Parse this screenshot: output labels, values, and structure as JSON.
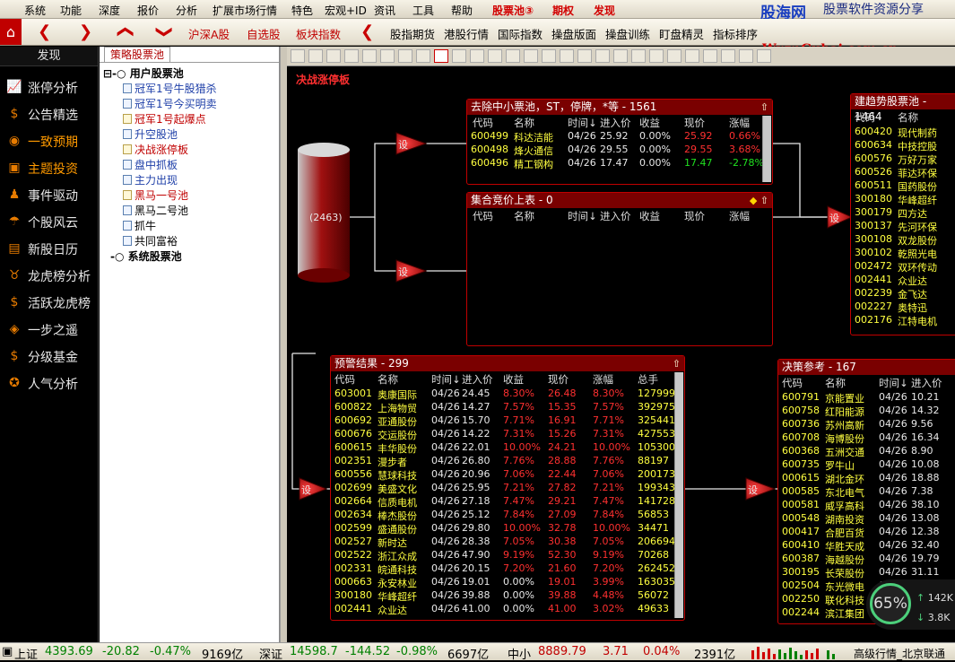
{
  "menubar": {
    "items": [
      "系统",
      "功能",
      "深度",
      "报价",
      "分析",
      "扩展市场行情",
      "特色",
      "宏观+ID",
      "资讯",
      "工具",
      "帮助"
    ],
    "stockpool": "股票池",
    "stockpool_badge": "③",
    "options": "期权",
    "ipo": "发现"
  },
  "watermark": {
    "brand": "股海网",
    "slogan": "股票软件资源分享",
    "url": "Www.Guhai.com.cn"
  },
  "toolbar": {
    "buttons": [
      "沪深A股",
      "自选股",
      "板块指数",
      "股指期货",
      "港股行情",
      "国际指数",
      "操盘版面",
      "操盘训练",
      "盯盘精灵",
      "指标排序"
    ]
  },
  "leftnav": {
    "title": "发现",
    "items": [
      "涨停分析",
      "公告精选",
      "一致预期",
      "主题投资",
      "事件驱动",
      "个股风云",
      "新股日历",
      "龙虎榜分析",
      "活跃龙虎榜",
      "一步之遥",
      "分级基金",
      "人气分析"
    ]
  },
  "tree": {
    "tab": "策略股票池",
    "user_pool": "用户股票池",
    "items": [
      "冠军1号牛股猎杀",
      "冠军1号今买明卖",
      "冠军1号起爆点",
      "升空股池",
      "决战涨停板",
      "盘中抓板",
      "主力出现",
      "黑马一号池",
      "黑马二号池",
      "抓牛",
      "共同富裕"
    ],
    "system_pool": "系统股票池"
  },
  "strategy_title": "决战涨停板",
  "pool_count": "(2463)",
  "set_label": "设",
  "headers": {
    "code": "代码",
    "name": "名称",
    "time": "时间↓",
    "entry": "进入价",
    "profit": "收益",
    "price": "现价",
    "change": "涨幅",
    "volume": "总手"
  },
  "panel_exclude": {
    "title": "去除中小票池，ST，停牌，*等 - 1561",
    "rows": [
      [
        "600499",
        "科达洁能",
        "04/26",
        "25.92",
        "0.00%",
        "25.92",
        "0.66%"
      ],
      [
        "600498",
        "烽火通信",
        "04/26",
        "29.55",
        "0.00%",
        "29.55",
        "3.68%"
      ],
      [
        "600496",
        "精工钢构",
        "04/26",
        "17.47",
        "0.00%",
        "17.47",
        "-2.78%"
      ]
    ]
  },
  "panel_auction": {
    "title": "集合竞价上表 - 0"
  },
  "panel_trend": {
    "title": "建趋势股票池 - 1464",
    "rows": [
      [
        "600420",
        "现代制药"
      ],
      [
        "600634",
        "中技控股"
      ],
      [
        "600576",
        "万好万家"
      ],
      [
        "600526",
        "菲达环保"
      ],
      [
        "600511",
        "国药股份"
      ],
      [
        "300180",
        "华峰超纤"
      ],
      [
        "300179",
        "四方达"
      ],
      [
        "300137",
        "先河环保"
      ],
      [
        "300108",
        "双龙股份"
      ],
      [
        "300102",
        "乾照光电"
      ],
      [
        "002472",
        "双环传动"
      ],
      [
        "002441",
        "众业达"
      ],
      [
        "002239",
        "金飞达"
      ],
      [
        "002227",
        "奥特迅"
      ],
      [
        "002176",
        "江特电机"
      ]
    ]
  },
  "panel_alert": {
    "title": "预警结果 - 299",
    "rows": [
      [
        "603001",
        "奥康国际",
        "04/26",
        "24.45",
        "8.30%",
        "26.48",
        "8.30%",
        "127999"
      ],
      [
        "600822",
        "上海物贸",
        "04/26",
        "14.27",
        "7.57%",
        "15.35",
        "7.57%",
        "392975"
      ],
      [
        "600692",
        "亚通股份",
        "04/26",
        "15.70",
        "7.71%",
        "16.91",
        "7.71%",
        "325441"
      ],
      [
        "600676",
        "交运股份",
        "04/26",
        "14.22",
        "7.31%",
        "15.26",
        "7.31%",
        "427553"
      ],
      [
        "600615",
        "丰华股份",
        "04/26",
        "22.01",
        "10.00%",
        "24.21",
        "10.00%",
        "105300"
      ],
      [
        "002351",
        "漫步者",
        "04/26",
        "26.80",
        "7.76%",
        "28.88",
        "7.76%",
        "88197"
      ],
      [
        "600556",
        "慧球科技",
        "04/26",
        "20.96",
        "7.06%",
        "22.44",
        "7.06%",
        "200173"
      ],
      [
        "002699",
        "美盛文化",
        "04/26",
        "25.95",
        "7.21%",
        "27.82",
        "7.21%",
        "199343"
      ],
      [
        "002664",
        "信质电机",
        "04/26",
        "27.18",
        "7.47%",
        "29.21",
        "7.47%",
        "141728"
      ],
      [
        "002634",
        "棒杰股份",
        "04/26",
        "25.12",
        "7.84%",
        "27.09",
        "7.84%",
        "56853"
      ],
      [
        "002599",
        "盛通股份",
        "04/26",
        "29.80",
        "10.00%",
        "32.78",
        "10.00%",
        "34471"
      ],
      [
        "002527",
        "新时达",
        "04/26",
        "28.38",
        "7.05%",
        "30.38",
        "7.05%",
        "206694"
      ],
      [
        "002522",
        "浙江众成",
        "04/26",
        "47.90",
        "9.19%",
        "52.30",
        "9.19%",
        "70268"
      ],
      [
        "002331",
        "皖通科技",
        "04/26",
        "20.15",
        "7.20%",
        "21.60",
        "7.20%",
        "262452"
      ],
      [
        "000663",
        "永安林业",
        "04/26",
        "19.01",
        "0.00%",
        "19.01",
        "3.99%",
        "163035"
      ],
      [
        "300180",
        "华峰超纤",
        "04/26",
        "39.88",
        "0.00%",
        "39.88",
        "4.48%",
        "56072"
      ],
      [
        "002441",
        "众业达",
        "04/26",
        "41.00",
        "0.00%",
        "41.00",
        "3.02%",
        "49633"
      ]
    ]
  },
  "panel_decision": {
    "title": "决策参考 - 167",
    "rows": [
      [
        "600791",
        "京能置业",
        "04/26",
        "10.21"
      ],
      [
        "600758",
        "红阳能源",
        "04/26",
        "14.32"
      ],
      [
        "600736",
        "苏州高新",
        "04/26",
        "9.56"
      ],
      [
        "600708",
        "海博股份",
        "04/26",
        "16.34"
      ],
      [
        "600368",
        "五洲交通",
        "04/26",
        "8.90"
      ],
      [
        "600735",
        "罗牛山",
        "04/26",
        "10.08"
      ],
      [
        "000615",
        "湖北金环",
        "04/26",
        "18.88"
      ],
      [
        "000585",
        "东北电气",
        "04/26",
        "7.38"
      ],
      [
        "000581",
        "威孚高科",
        "04/26",
        "38.10"
      ],
      [
        "000548",
        "湖南投资",
        "04/26",
        "13.08"
      ],
      [
        "000417",
        "合肥百货",
        "04/26",
        "12.38"
      ],
      [
        "600410",
        "华胜天成",
        "04/26",
        "32.40"
      ],
      [
        "600387",
        "海越股份",
        "04/26",
        "19.79"
      ],
      [
        "300195",
        "长荣股份",
        "04/26",
        "31.11"
      ],
      [
        "002504",
        "东光微电",
        "04/26",
        "25.85"
      ],
      [
        "002250",
        "联化科技",
        "04/26",
        ""
      ],
      [
        "002244",
        "滨江集团",
        "04/26",
        ""
      ]
    ]
  },
  "speed": {
    "percent": "65%",
    "up": "142K",
    "down": "3.8K"
  },
  "status": {
    "sh_label": "上证",
    "sh_val": "4393.69",
    "sh_chg": "-20.82",
    "sh_pct": "-0.47%",
    "sh_amt": "9169亿",
    "sz_label": "深证",
    "sz_val": "14598.7",
    "sz_chg": "-144.52",
    "sz_pct": "-0.98%",
    "sz_amt": "6697亿",
    "zx_label": "中小",
    "zx_val": "8889.79",
    "zx_chg": "3.71",
    "zx_pct": "0.04%",
    "zx_amt": "2391亿",
    "server": "高级行情_北京联通"
  }
}
